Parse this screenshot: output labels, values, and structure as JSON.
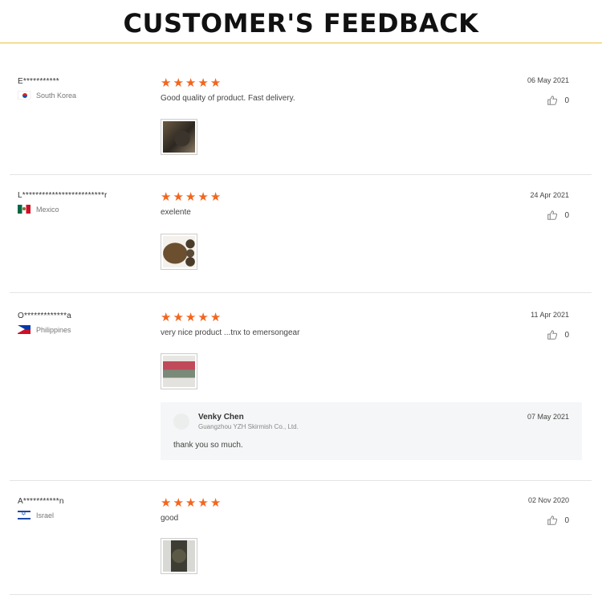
{
  "header": {
    "title": "CUSTOMER'S FEEDBACK"
  },
  "colors": {
    "star": "#f2661f",
    "header_rule": "#e8c23a"
  },
  "reviews": [
    {
      "user": "E***********",
      "country": "South Korea",
      "flag_icon": "south-korea-flag-icon",
      "rating": 5,
      "text": "Good quality of product. Fast delivery.",
      "date": "06 May 2021",
      "likes": "0",
      "photo_icon": "product-photo-thumbnail"
    },
    {
      "user": "L*************************r",
      "country": "Mexico",
      "flag_icon": "mexico-flag-icon",
      "rating": 5,
      "text": "exelente",
      "date": "24 Apr 2021",
      "likes": "0",
      "photo_icon": "product-photo-thumbnail"
    },
    {
      "user": "O*************a",
      "country": "Philippines",
      "flag_icon": "philippines-flag-icon",
      "rating": 5,
      "text": "very nice product ...tnx to emersongear",
      "date": "11 Apr 2021",
      "likes": "0",
      "photo_icon": "product-photo-thumbnail",
      "reply": {
        "name": "Venky Chen",
        "company": "Guangzhou YZH Skirmish Co., Ltd.",
        "text": "thank you so much.",
        "date": "07 May 2021"
      }
    },
    {
      "user": "A***********n",
      "country": "Israel",
      "flag_icon": "israel-flag-icon",
      "rating": 5,
      "text": "good",
      "date": "02 Nov 2020",
      "likes": "0",
      "photo_icon": "product-photo-thumbnail"
    }
  ]
}
